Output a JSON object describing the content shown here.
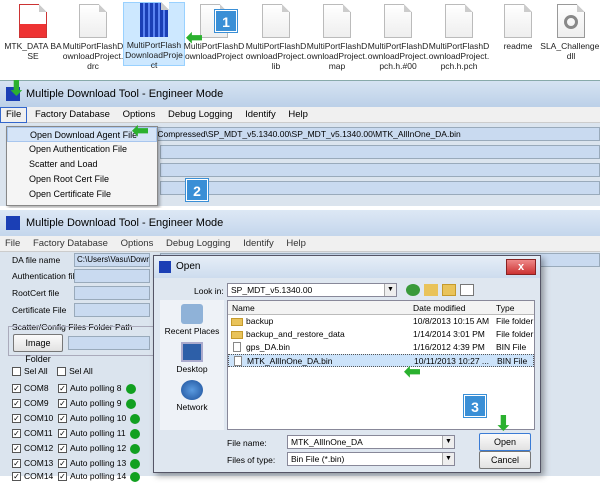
{
  "explorer": {
    "files": [
      {
        "label": "MTK_DATA BASE",
        "type": "pdf"
      },
      {
        "label": "MultiPortFlashDownloadProject.drc",
        "type": "doc"
      },
      {
        "label": "MultiPortFlashDownloadProject",
        "type": "app",
        "selected": true
      },
      {
        "label": "MultiPortFlashDownloadProject",
        "type": "doc"
      },
      {
        "label": "MultiPortFlashDownloadProject.lib",
        "type": "doc"
      },
      {
        "label": "MultiPortFlashDownloadProject.map",
        "type": "doc"
      },
      {
        "label": "MultiPortFlashDownloadProject.pch.h.#00",
        "type": "doc"
      },
      {
        "label": "MultiPortFlashDownloadProject.pch.h.pch",
        "type": "doc"
      },
      {
        "label": "readme",
        "type": "doc"
      },
      {
        "label": "SLA_Challenge.dll",
        "type": "dll"
      }
    ]
  },
  "steps": {
    "one": "1",
    "two": "2",
    "three": "3"
  },
  "window1": {
    "title": "Multiple Download Tool - Engineer Mode",
    "menu": [
      "File",
      "Factory Database",
      "Options",
      "Debug Logging",
      "Identify",
      "Help"
    ],
    "path": "\\Compressed\\SP_MDT_v5.1340.00\\SP_MDT_v5.1340.00\\MTK_AllInOne_DA.bin",
    "file_menu": [
      "Open Download Agent File",
      "Open Authentication File",
      "Scatter and Load",
      "Open Root Cert File",
      "Open Certificate File"
    ]
  },
  "window2": {
    "title": "Multiple Download Tool - Engineer Mode",
    "menu": [
      "File",
      "Factory Database",
      "Options",
      "Debug Logging",
      "Identify",
      "Help"
    ],
    "da_label": "DA file name",
    "da_value": "C:\\Users\\Vasu\\Downloa",
    "auth_label": "Authentication file",
    "rootcert_label": "RootCert file",
    "cert_label": "Certificate File",
    "scatter_group": "Scatter/Config Files Folder Path",
    "image_folder_button": "Image Folder",
    "sel_all_1": "Sel All",
    "sel_all_2": "Sel All",
    "ports": [
      {
        "port": "COM8",
        "auto": "Auto polling 8"
      },
      {
        "port": "COM9",
        "auto": "Auto polling 9"
      },
      {
        "port": "COM10",
        "auto": "Auto polling 10"
      },
      {
        "port": "COM11",
        "auto": "Auto polling 11"
      },
      {
        "port": "COM12",
        "auto": "Auto polling 12"
      },
      {
        "port": "COM13",
        "auto": "Auto polling 13"
      },
      {
        "port": "COM14",
        "auto": "Auto polling 14"
      }
    ],
    "status_color": "#11a020"
  },
  "open_dialog": {
    "title": "Open",
    "close": "x",
    "look_in_label": "Look in:",
    "look_in_value": "SP_MDT_v5.1340.00",
    "places": [
      "Recent Places",
      "Desktop",
      "Network"
    ],
    "columns": {
      "name": "Name",
      "date": "Date modified",
      "type": "Type"
    },
    "rows": [
      {
        "name": "backup",
        "date": "10/8/2013 10:15 AM",
        "type": "File folder",
        "kind": "folder"
      },
      {
        "name": "backup_and_restore_data",
        "date": "1/14/2014 3:01 PM",
        "type": "File folder",
        "kind": "folder"
      },
      {
        "name": "gps_DA.bin",
        "date": "1/16/2012 4:39 PM",
        "type": "BIN File",
        "kind": "file"
      },
      {
        "name": "MTK_AllInOne_DA.bin",
        "date": "10/11/2013 10:27 ...",
        "type": "BIN File",
        "kind": "file",
        "selected": true
      }
    ],
    "file_name_label": "File name:",
    "file_name_value": "MTK_AllInOne_DA",
    "files_of_type_label": "Files of type:",
    "files_of_type_value": "Bin File (*.bin)",
    "open_button": "Open",
    "cancel_button": "Cancel"
  }
}
